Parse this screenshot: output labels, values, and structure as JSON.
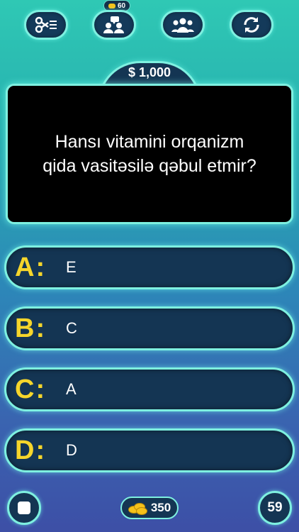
{
  "lifelines": {
    "fifty_fifty": {
      "icon": "scissors-icon"
    },
    "ask_friend": {
      "icon": "people-chat-icon",
      "cost": "60"
    },
    "audience": {
      "icon": "group-icon"
    },
    "switch": {
      "icon": "refresh-icon"
    }
  },
  "prize": "$ 1,000",
  "question": "Hansı vitamini orqanizm\nqida vasitəsilə qəbul etmir?",
  "answers": [
    {
      "letter": "A:",
      "text": "E"
    },
    {
      "letter": "B:",
      "text": "C"
    },
    {
      "letter": "C:",
      "text": "A"
    },
    {
      "letter": "D:",
      "text": "D"
    }
  ],
  "footer": {
    "coins": "350",
    "timer": "59",
    "stop_icon": "stop-icon"
  },
  "colors": {
    "accent": "#7ef0e0",
    "letter": "#f6d62b",
    "panel": "#143553"
  }
}
